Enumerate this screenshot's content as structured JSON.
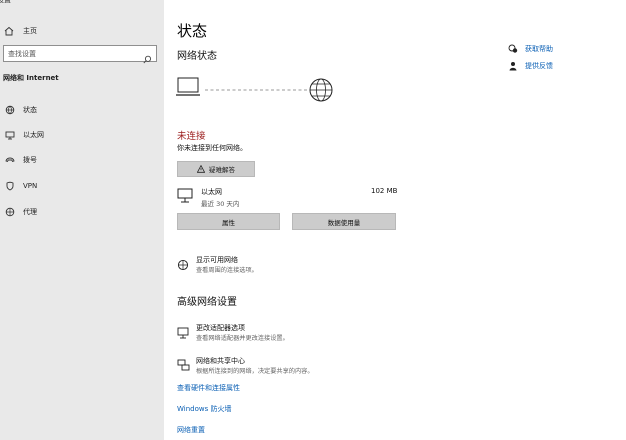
{
  "window": {
    "title": "设置"
  },
  "sidebar": {
    "home_label": "主页",
    "search_placeholder": "查找设置",
    "section_label": "网络和 Internet",
    "items": [
      {
        "label": "状态",
        "icon": "home-globe-icon"
      },
      {
        "label": "以太网",
        "icon": "ethernet-icon"
      },
      {
        "label": "拨号",
        "icon": "dialup-icon"
      },
      {
        "label": "VPN",
        "icon": "vpn-icon"
      },
      {
        "label": "代理",
        "icon": "globe-icon"
      }
    ]
  },
  "main": {
    "title": "状态",
    "network_status_heading": "网络状态",
    "status": "未连接",
    "status_desc": "你未连接到任何网络。",
    "troubleshoot_label": "疑难解答",
    "ethernet": {
      "name": "以太网",
      "sub": "最近 30 天内",
      "usage": "102 MB"
    },
    "properties_label": "属性",
    "data_usage_label": "数据使用量",
    "show_networks": {
      "title": "显示可用网络",
      "sub": "查看周围的连接选项。"
    },
    "advanced_heading": "高级网络设置",
    "adapter_options": {
      "title": "更改适配器选项",
      "sub": "查看网络适配器并更改连接设置。"
    },
    "sharing_center": {
      "title": "网络和共享中心",
      "sub": "根据所连接到的网络，决定要共享的内容。"
    },
    "links": [
      "查看硬件和连接属性",
      "Windows 防火墙",
      "网络重置"
    ]
  },
  "right": {
    "help_label": "获取帮助",
    "feedback_label": "提供反馈"
  },
  "colors": {
    "sidebar_bg": "#e9e9e9",
    "link": "#0a5fb4",
    "error": "#9b1c1c",
    "button_bg": "#cccccc"
  }
}
